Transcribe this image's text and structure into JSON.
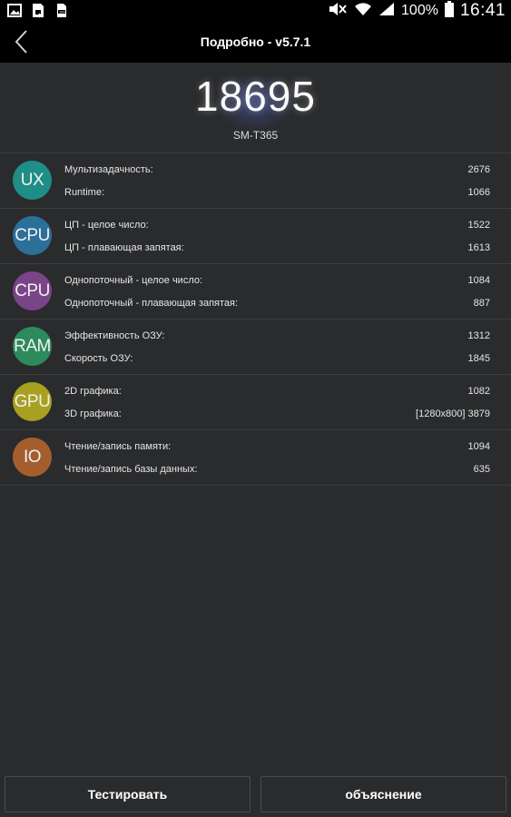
{
  "status_bar": {
    "icons_left": [
      "image-icon",
      "sd-card-icon",
      "storage-icon"
    ],
    "battery_text": "100%",
    "time": "16:41"
  },
  "header": {
    "title": "Подробно - v5.7.1"
  },
  "score": {
    "total": "18695",
    "model": "SM-T365"
  },
  "rows": [
    {
      "badge": "UX",
      "color": "#1e8e86",
      "items": [
        {
          "label": "Мультизадачность:",
          "value": "2676"
        },
        {
          "label": "Runtime:",
          "value": "1066"
        }
      ]
    },
    {
      "badge": "CPU",
      "color": "#2c6f98",
      "items": [
        {
          "label": "ЦП - целое число:",
          "value": "1522"
        },
        {
          "label": "ЦП - плавающая запятая:",
          "value": "1613"
        }
      ]
    },
    {
      "badge": "CPU",
      "color": "#7a4488",
      "items": [
        {
          "label": "Однопоточный - целое число:",
          "value": "1084"
        },
        {
          "label": "Однопоточный - плавающая запятая:",
          "value": "887"
        }
      ]
    },
    {
      "badge": "RAM",
      "color": "#2d8a5d",
      "items": [
        {
          "label": "Эффективность ОЗУ:",
          "value": "1312"
        },
        {
          "label": "Скорость ОЗУ:",
          "value": "1845"
        }
      ]
    },
    {
      "badge": "GPU",
      "color": "#a8a020",
      "items": [
        {
          "label": "2D графика:",
          "value": "1082"
        },
        {
          "label": "3D графика:",
          "value": "[1280x800] 3879"
        }
      ]
    },
    {
      "badge": "IO",
      "color": "#a45e2e",
      "items": [
        {
          "label": "Чтение/запись памяти:",
          "value": "1094"
        },
        {
          "label": "Чтение/запись базы данных:",
          "value": "635"
        }
      ]
    }
  ],
  "buttons": {
    "test": "Тестировать",
    "explain": "объяснение"
  }
}
